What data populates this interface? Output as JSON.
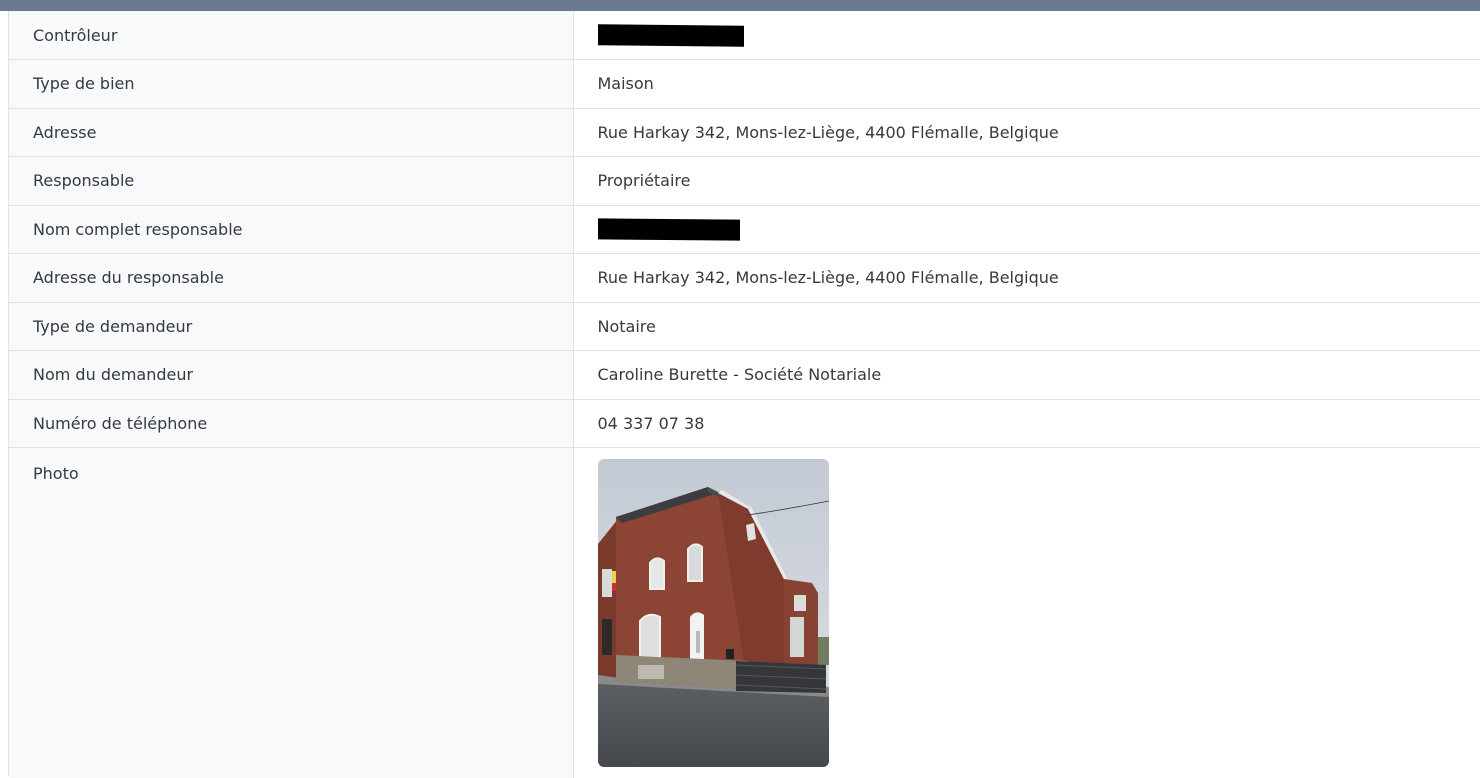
{
  "rows": [
    {
      "label": "Contrôleur",
      "value": "",
      "redacted": true
    },
    {
      "label": "Type de bien",
      "value": "Maison"
    },
    {
      "label": "Adresse",
      "value": "Rue Harkay 342, Mons-lez-Liège, 4400 Flémalle, Belgique"
    },
    {
      "label": "Responsable",
      "value": "Propriétaire"
    },
    {
      "label": "Nom complet responsable",
      "value": "",
      "redacted": true
    },
    {
      "label": "Adresse du responsable",
      "value": "Rue Harkay 342, Mons-lez-Liège, 4400 Flémalle, Belgique"
    },
    {
      "label": "Type de demandeur",
      "value": "Notaire"
    },
    {
      "label": "Nom du demandeur",
      "value": "Caroline Burette - Société Notariale"
    },
    {
      "label": "Numéro de téléphone",
      "value": "04 337 07 38"
    }
  ],
  "photo": {
    "label": "Photo",
    "icon": "house-photo"
  },
  "colors": {
    "header_bar": "#6c7a91",
    "label_bg": "#f8f9fa",
    "border": "#dee2e6",
    "text": "#343a40"
  }
}
